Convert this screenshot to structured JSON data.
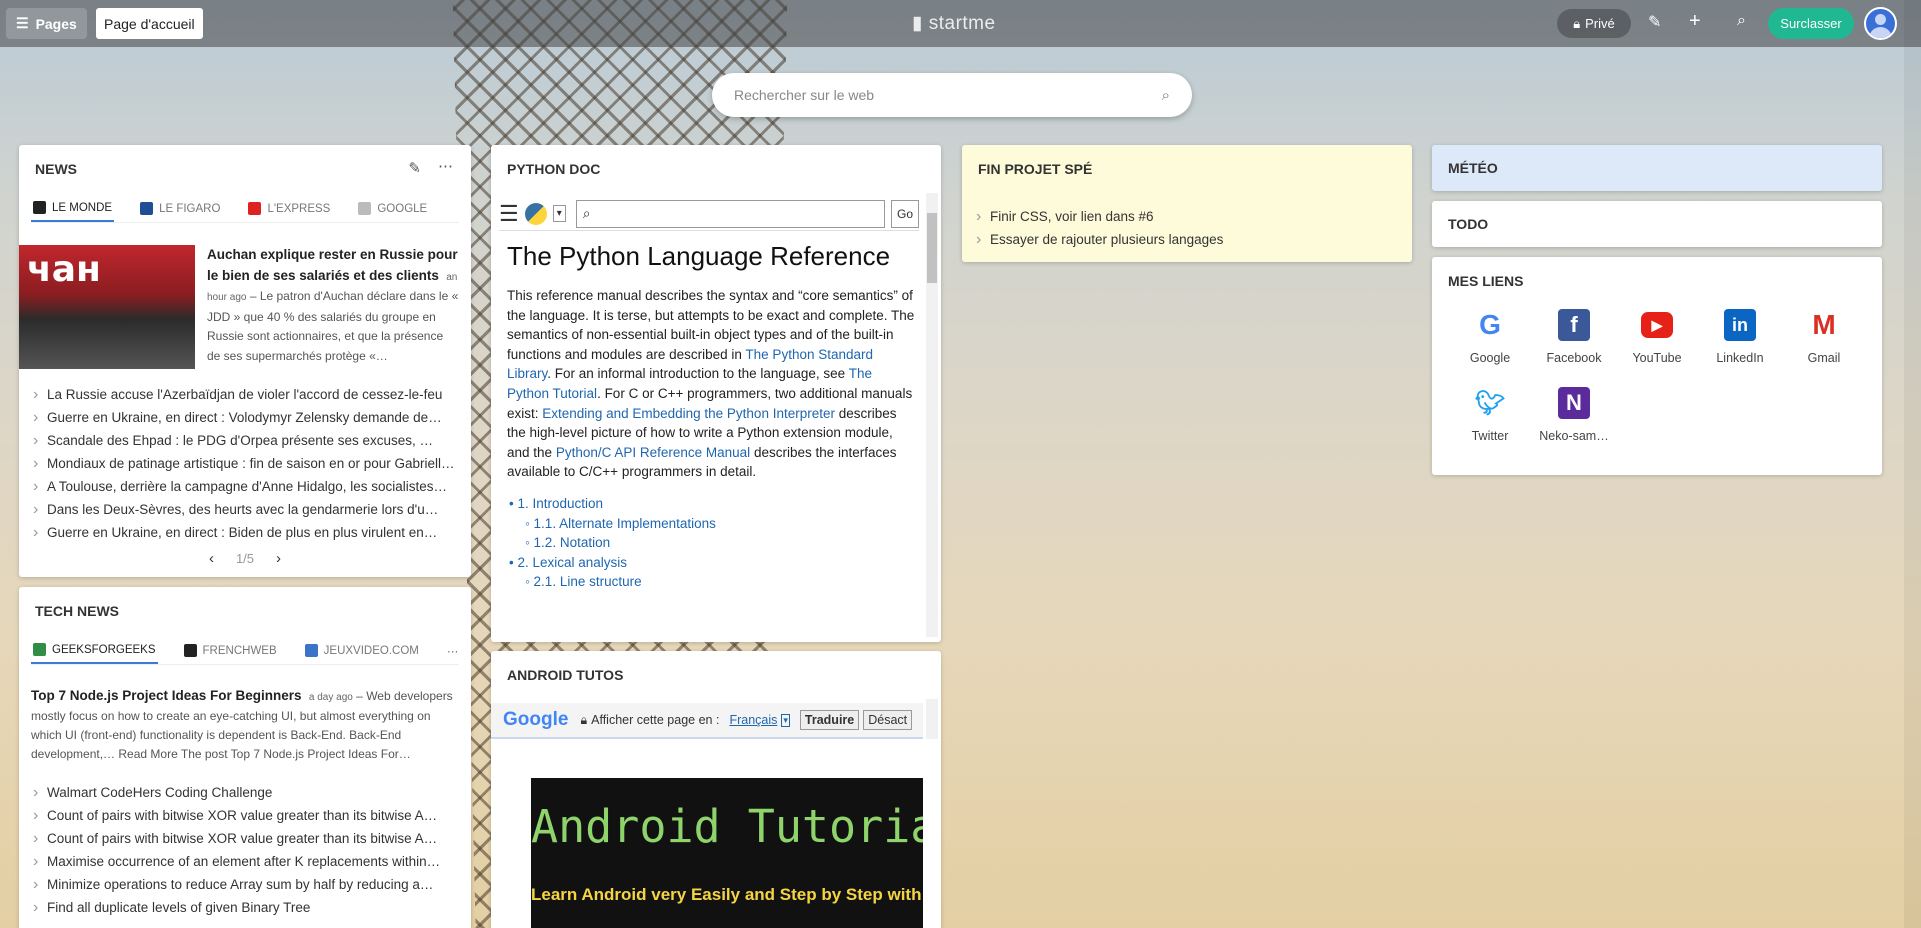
{
  "topbar": {
    "pages_label": "Pages",
    "home_tab": "Page d'accueil",
    "logo": "startme",
    "private_label": "Privé",
    "upgrade_label": "Surclasser"
  },
  "search": {
    "placeholder": "Rechercher sur le web"
  },
  "news": {
    "title": "NEWS",
    "tabs": [
      "LE MONDE",
      "LE FIGARO",
      "L'EXPRESS",
      "GOOGLE"
    ],
    "featured_title": "Auchan explique rester en Russie pour le bien de ses salariés et des clients",
    "featured_time": "an hour ago",
    "featured_text": "Le patron d'Auchan déclare dans le « JDD » que 40 % des salariés du groupe en Russie sont actionnaires, et que la présence de ses supermarchés protège «…",
    "items": [
      "La Russie accuse l'Azerbaïdjan de violer l'accord de cessez-le-feu",
      "Guerre en Ukraine, en direct : Volodymyr Zelensky demande de…",
      "Scandale des Ehpad : le PDG d'Orpea présente ses excuses, …",
      "Mondiaux de patinage artistique : fin de saison en or pour Gabriella…",
      "A Toulouse, derrière la campagne d'Anne Hidalgo, les socialistes…",
      "Dans les Deux-Sèvres, des heurts avec la gendarmerie lors d'u…",
      "Guerre en Ukraine, en direct : Biden de plus en plus virulent en…"
    ],
    "pager": "1/5"
  },
  "tech": {
    "title": "TECH NEWS",
    "tabs": [
      "GEEKSFORGEEKS",
      "FRENCHWEB",
      "JEUXVIDEO.COM"
    ],
    "featured_title": "Top 7 Node.js Project Ideas For Beginners",
    "featured_time": "a day ago",
    "featured_text": "Web developers mostly focus on how to create an eye-catching UI, but almost everything on which UI (front-end) functionality is dependent is Back-End. Back-End development,… Read More The post Top 7 Node.js Project Ideas For…",
    "items": [
      "Walmart CodeHers Coding Challenge",
      "Count of pairs with bitwise XOR value greater than its bitwise A…",
      "Count of pairs with bitwise XOR value greater than its bitwise A…",
      "Maximise occurrence of an element after K replacements within…",
      "Minimize operations to reduce Array sum by half by reducing a…",
      "Find all duplicate levels of given Binary Tree"
    ]
  },
  "python": {
    "title": "PYTHON DOC",
    "go": "Go",
    "heading": "The Python Language Reference",
    "p1": "This reference manual describes the syntax and “core semantics” of the language. It is terse, but attempts to be exact and complete. The semantics of non-essential built-in object types and of the built-in functions and modules are described in",
    "l1": "The Python Standard Library",
    "p2": ". For an informal introduction to the language, see",
    "l2": "The Python Tutorial",
    "p3": ". For C or C++ programmers, two additional manuals exist:",
    "l3": "Extending and Embedding the Python Interpreter",
    "p4": "describes the high-level picture of how to write a Python extension module, and the",
    "l4": "Python/C API Reference Manual",
    "p5": "describes the interfaces available to C/C++ programmers in detail.",
    "toc": [
      "1. Introduction",
      "1.1. Alternate Implementations",
      "1.2. Notation",
      "2. Lexical analysis",
      "2.1. Line structure"
    ]
  },
  "android": {
    "title": "ANDROID TUTOS",
    "translate_prompt": "Afficher cette page en :",
    "language": "Français",
    "translate_btn": "Traduire",
    "deactivate_btn": "Désact",
    "banner_title": "Android Tutorials fo",
    "banner_sub": "Learn Android very Easily and Step by Step with"
  },
  "projet": {
    "title": "FIN PROJET SPÉ",
    "items": [
      "Finir CSS, voir lien dans #6",
      "Essayer de rajouter plusieurs langages"
    ]
  },
  "meteo": {
    "title": "MÉTÉO"
  },
  "todo": {
    "title": "TODO"
  },
  "liens": {
    "title": "MES LIENS",
    "items": [
      "Google",
      "Facebook",
      "YouTube",
      "LinkedIn",
      "Gmail",
      "Twitter",
      "Neko-sam…"
    ]
  },
  "colors": {
    "accent": "#1fb892",
    "link": "#1f66b0",
    "note": "#fdfbd9",
    "meteo": "#dde9f8"
  }
}
